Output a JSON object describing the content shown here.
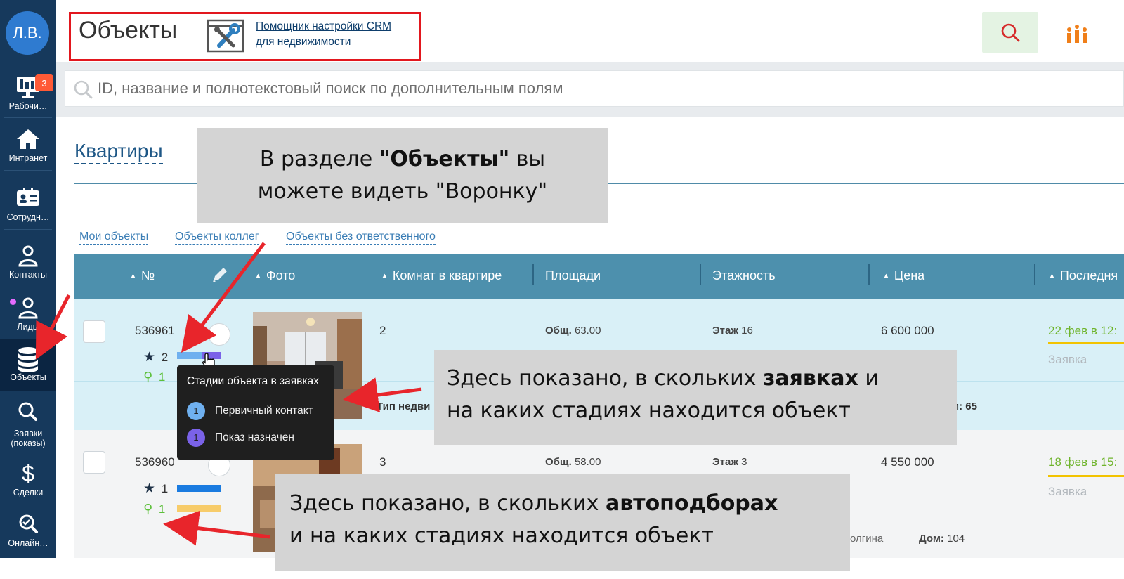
{
  "sidebar": {
    "avatar": "Л.В.",
    "badge": "3",
    "items": [
      {
        "label": "Рабочи…",
        "icon": "monitor-icon"
      },
      {
        "label": "Интранет",
        "icon": "home-icon"
      },
      {
        "label": "Сотрудн…",
        "icon": "id-card-icon"
      },
      {
        "label": "Контакты",
        "icon": "person-icon"
      },
      {
        "label": "Лиды",
        "icon": "person-icon"
      },
      {
        "label": "Объекты",
        "icon": "database-icon"
      },
      {
        "label": "Заявки",
        "label2": "(показы)",
        "icon": "search-icon"
      },
      {
        "label": "Сделки",
        "icon": "dollar-icon"
      },
      {
        "label": "Онлайн…",
        "icon": "online-search-icon"
      }
    ]
  },
  "header": {
    "title": "Объекты",
    "wizard_line1": "Помощник настройки CRM",
    "wizard_line2": "для недвижимости"
  },
  "search": {
    "placeholder": "ID, название и полнотекстовый поиск по дополнительным полям"
  },
  "section": {
    "title": "Квартиры"
  },
  "filters": [
    "Мои объекты",
    "Объекты коллег",
    "Объекты без ответственного"
  ],
  "table": {
    "headers": {
      "number": "№",
      "photo": "Фото",
      "rooms": "Комнат в квартире",
      "area": "Площади",
      "floors": "Этажность",
      "price": "Цена",
      "last": "Последня"
    },
    "rows": [
      {
        "id": "536961",
        "stars": "2",
        "searches": "1",
        "rooms": "2",
        "area_label": "Общ.",
        "area_value": "63.00",
        "floor_label": "Этаж",
        "floor_value": "16",
        "price": "6 600 000",
        "date": "22 фев в 12:",
        "status": "Заявка",
        "type_label": "Тип недви",
        "extra": "м: 65"
      },
      {
        "id": "536960",
        "stars": "1",
        "searches": "1",
        "rooms": "3",
        "area_label": "Общ.",
        "area_value": "58.00",
        "floor_label": "Этаж",
        "floor_value": "3",
        "price": "4 550 000",
        "date": "18 фев в 15:",
        "status": "Заявка",
        "street": "олгина",
        "house_label": "Дом:",
        "house_value": "104"
      }
    ]
  },
  "tooltip": {
    "title": "Стадии объекта в заявках",
    "stages": [
      {
        "num": "1",
        "label": "Первичный контакт",
        "color": "#6fb0ef"
      },
      {
        "num": "1",
        "label": "Показ назначен",
        "color": "#7a62e8"
      }
    ]
  },
  "callouts": {
    "c1_pre": "В разделе ",
    "c1_bold": "\"Объекты\"",
    "c1_post": " вы",
    "c1_line2": "можете видеть \"Воронку\"",
    "c2_pre": "Здесь показано, в скольких ",
    "c2_bold": "заявках",
    "c2_post": " и",
    "c2_line2": "на каких стадиях находится объект",
    "c3_pre": "Здесь показано, в скольких ",
    "c3_bold": "автоподборах",
    "c3_line2": "и на каких стадиях находится объект"
  },
  "colors": {
    "sidebar": "#16395c",
    "table_header": "#4d90ad",
    "highlight_row": "#d9f0f7",
    "annotation_red": "#e8252b",
    "callout_bg": "#d4d4d4",
    "bar_blue": "#1a7be0",
    "bar_yellow": "#f7cc6a"
  }
}
